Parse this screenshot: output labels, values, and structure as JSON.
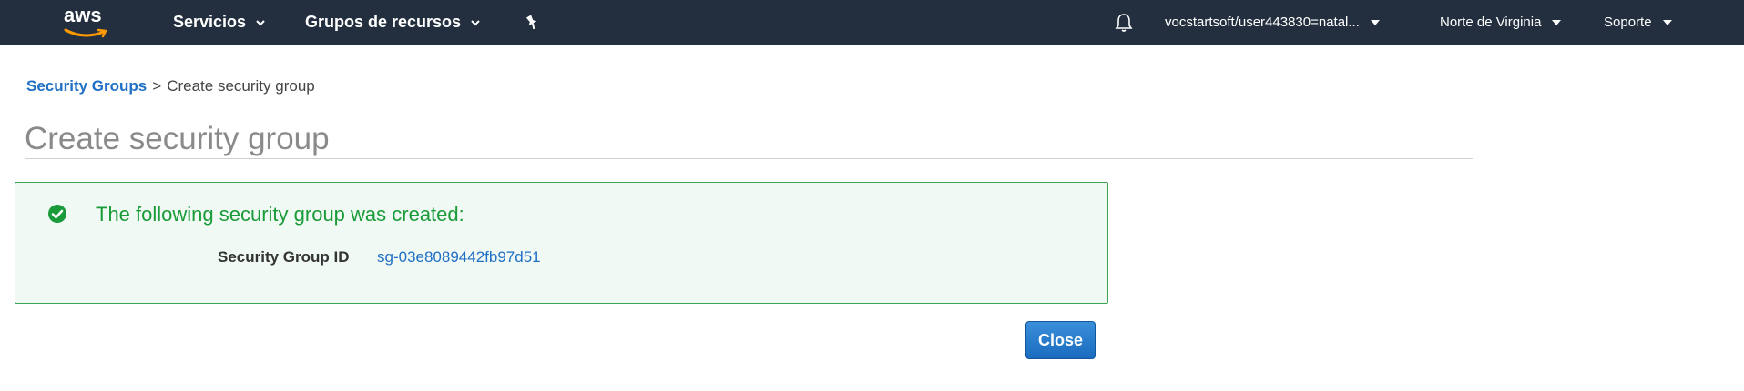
{
  "topnav": {
    "logo_text": "aws",
    "services_label": "Servicios",
    "resource_groups_label": "Grupos de recursos",
    "pin_icon": "pin-icon",
    "bell_icon": "bell-icon",
    "account_label": "vocstartsoft/user443830=natal...",
    "region_label": "Norte de Virginia",
    "support_label": "Soporte"
  },
  "breadcrumb": {
    "parent": "Security Groups",
    "separator": ">",
    "current": "Create security group"
  },
  "page": {
    "title": "Create security group"
  },
  "success": {
    "icon": "check-circle-icon",
    "message": "The following security group was created:",
    "id_label": "Security Group ID",
    "id_value": "sg-03e8089442fb97d51"
  },
  "actions": {
    "close_label": "Close"
  },
  "colors": {
    "nav_bg": "#232f3e",
    "link": "#1f6fc5",
    "success_green": "#1a9b39",
    "success_bg": "#f0f9f3",
    "button_blue": "#1a6bbf",
    "aws_orange": "#ff9900"
  }
}
